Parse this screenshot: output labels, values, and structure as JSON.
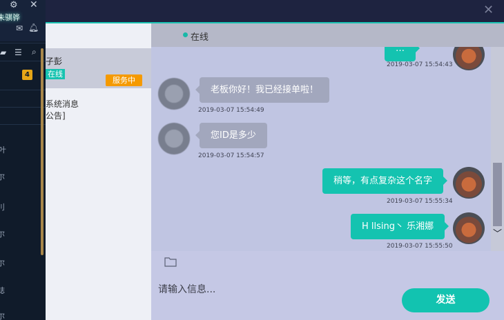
{
  "left_panel": {
    "username": "朱骐骅",
    "unread_count": "4",
    "nav_labels": [
      "叶",
      "尔",
      "刂",
      "尔",
      "尔",
      "誌",
      "尔"
    ]
  },
  "conversation_list": {
    "items": [
      {
        "name": "子彭",
        "status": "在线",
        "badge": "服务中"
      },
      {
        "name": "系统消息",
        "subtitle": "公告]"
      }
    ]
  },
  "chat": {
    "status_text": "在线",
    "messages": [
      {
        "from": "agent",
        "text": "…",
        "time": "2019-03-07 15:54:43"
      },
      {
        "from": "user",
        "text": "老板你好！我已经接单啦！",
        "time": "2019-03-07 15:54:49"
      },
      {
        "from": "user",
        "text": "您ID是多少",
        "time": "2019-03-07 15:54:57"
      },
      {
        "from": "agent",
        "text": "稍等，有点复杂这个名字",
        "time": "2019-03-07 15:55:34"
      },
      {
        "from": "agent",
        "text": "H llsing丶 乐湘娜",
        "time": "2019-03-07 15:55:50"
      }
    ],
    "input_placeholder": "请输入信息...",
    "send_label": "发送"
  },
  "colors": {
    "accent": "#14c3b0",
    "badge_orange": "#f59a00",
    "unread_yellow": "#e6a617"
  },
  "icons": [
    "gear-icon",
    "close-icon",
    "mail-icon",
    "bell-icon",
    "folder-icon",
    "list-icon",
    "search-icon",
    "chevron-down-icon"
  ]
}
